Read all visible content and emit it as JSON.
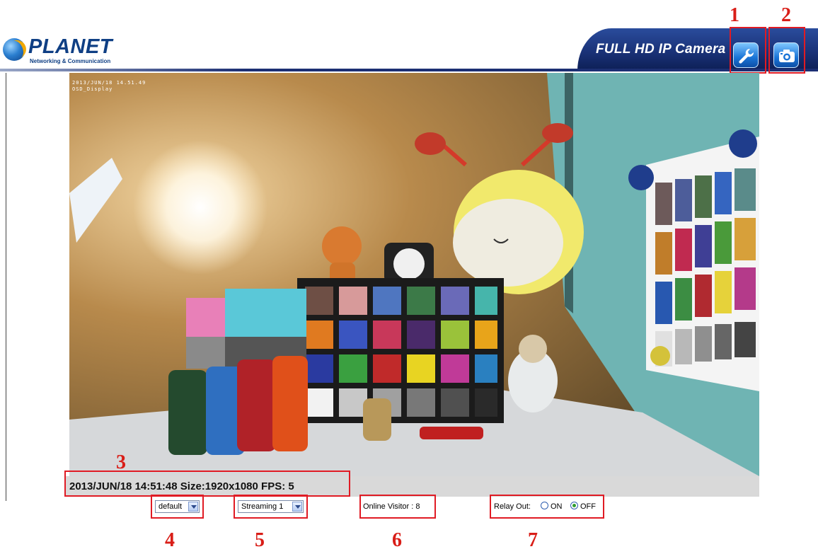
{
  "header": {
    "logo_text": "PLANET",
    "logo_tagline": "Networking & Communication",
    "product_title": "FULL HD IP Camera",
    "setting_icon": "wrench-icon",
    "snapshot_icon": "camera-icon"
  },
  "video": {
    "osd_line1": "2013/JUN/18 14.51.49",
    "osd_line2": "OSD_Display"
  },
  "status_bar": {
    "text": "2013/JUN/18 14:51:48 Size:1920x1080 FPS:  5"
  },
  "controls": {
    "view_select": "default",
    "stream_select": "Streaming 1",
    "online_visitor": "Online Visitor : 8",
    "relay_label": "Relay Out:",
    "relay_on": "ON",
    "relay_off": "OFF",
    "relay_selected": "OFF"
  },
  "callouts": {
    "n1": "1",
    "n2": "2",
    "n3": "3",
    "n4": "4",
    "n5": "5",
    "n6": "6",
    "n7": "7"
  },
  "colors": {
    "callout": "#e01b24",
    "brand": "#1c2f73"
  }
}
